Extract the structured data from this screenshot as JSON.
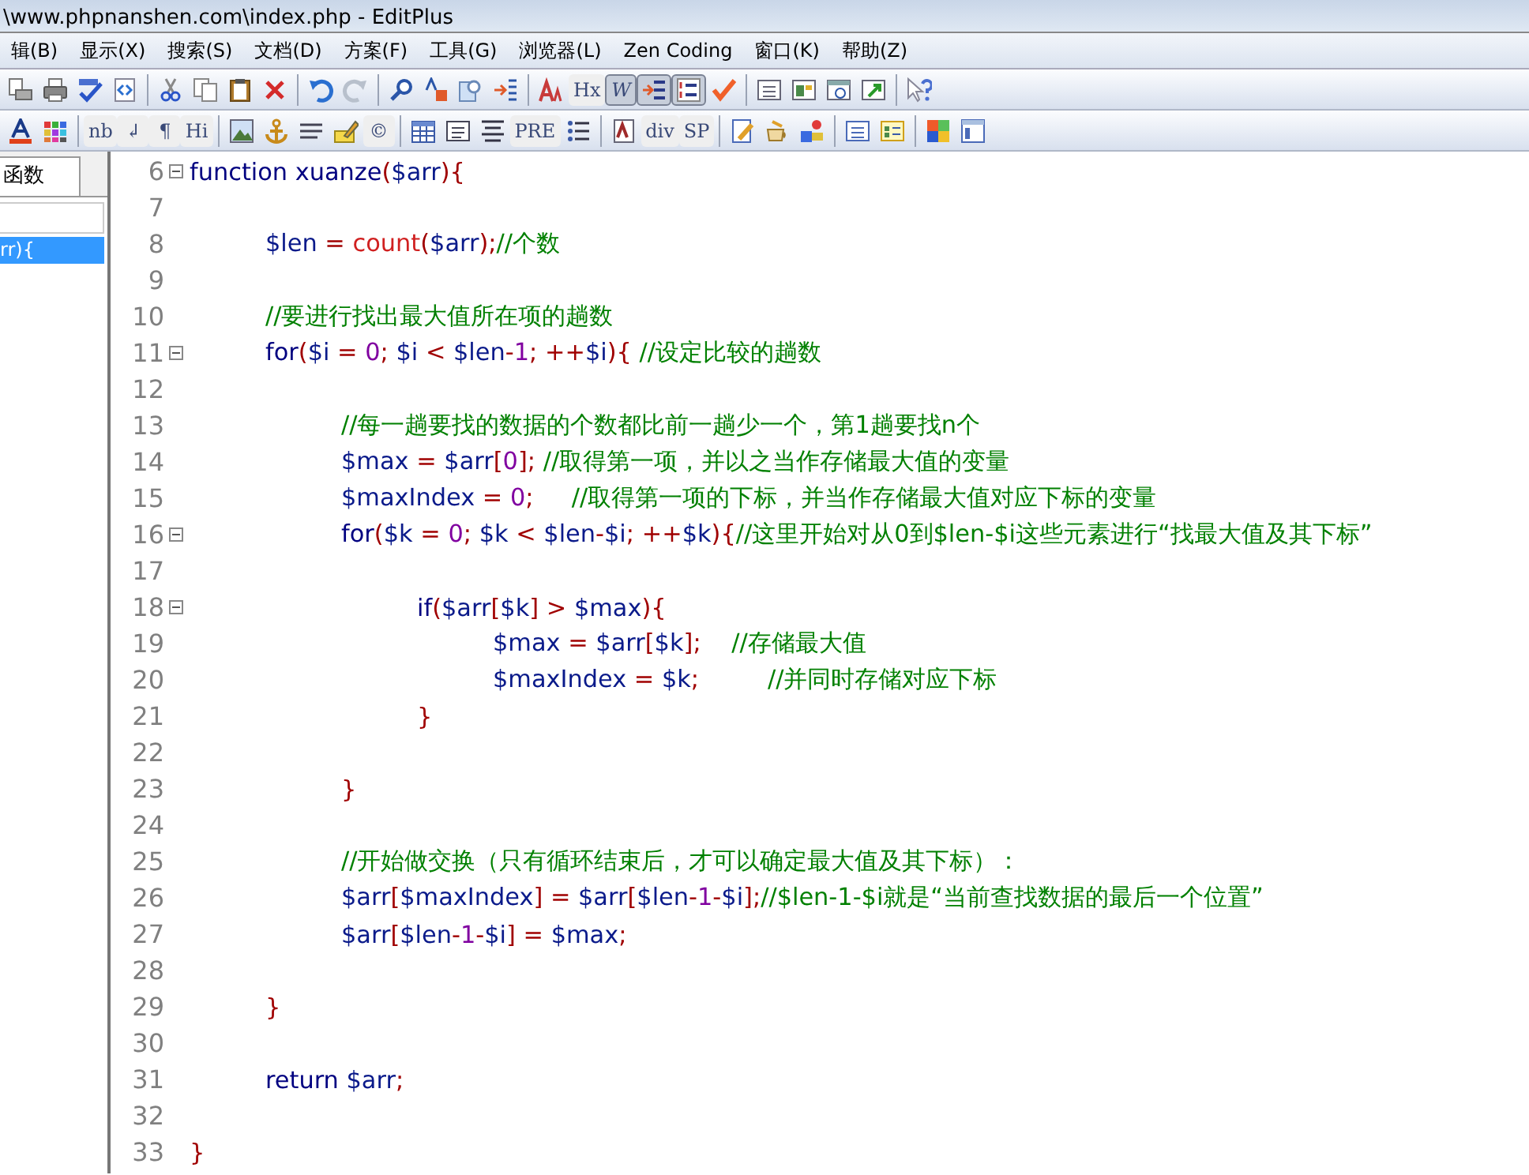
{
  "window": {
    "title": "\\www.phpnanshen.com\\index.php - EditPlus"
  },
  "menu": [
    "辑(B)",
    "显示(X)",
    "搜索(S)",
    "文档(D)",
    "方案(F)",
    "工具(G)",
    "浏览器(L)",
    "Zen Coding",
    "窗口(K)",
    "帮助(Z)"
  ],
  "toolbars": [
    [
      {
        "kind": "icon"
      },
      {
        "kind": "icon"
      },
      {
        "kind": "icon"
      },
      {
        "kind": "icon"
      },
      {
        "kind": "sep"
      },
      {
        "kind": "icon"
      },
      {
        "kind": "icon"
      },
      {
        "kind": "icon"
      },
      {
        "kind": "icon"
      },
      {
        "kind": "sep"
      },
      {
        "kind": "icon"
      },
      {
        "kind": "icon"
      },
      {
        "kind": "sep"
      },
      {
        "kind": "icon"
      },
      {
        "kind": "icon"
      },
      {
        "kind": "icon"
      },
      {
        "kind": "icon"
      },
      {
        "kind": "sep"
      },
      {
        "kind": "icon"
      },
      {
        "kind": "text",
        "label": "Hx",
        "selected": false
      },
      {
        "kind": "text",
        "label": "W",
        "selected": true
      },
      {
        "kind": "icon",
        "selected": true
      },
      {
        "kind": "icon",
        "selected": true
      },
      {
        "kind": "icon"
      },
      {
        "kind": "sep"
      },
      {
        "kind": "icon"
      },
      {
        "kind": "icon"
      },
      {
        "kind": "icon"
      },
      {
        "kind": "icon"
      },
      {
        "kind": "sep"
      },
      {
        "kind": "icon"
      }
    ],
    [
      {
        "kind": "icon"
      },
      {
        "kind": "icon"
      },
      {
        "kind": "sep"
      },
      {
        "kind": "text",
        "label": "nb",
        "selected": false
      },
      {
        "kind": "text",
        "label": "↲",
        "selected": false
      },
      {
        "kind": "text",
        "label": "¶",
        "selected": false
      },
      {
        "kind": "text",
        "label": "Hi",
        "selected": false
      },
      {
        "kind": "sep"
      },
      {
        "kind": "icon"
      },
      {
        "kind": "icon"
      },
      {
        "kind": "icon"
      },
      {
        "kind": "icon"
      },
      {
        "kind": "text",
        "label": "©",
        "selected": false
      },
      {
        "kind": "sep"
      },
      {
        "kind": "icon"
      },
      {
        "kind": "icon"
      },
      {
        "kind": "icon"
      },
      {
        "kind": "text",
        "label": "PRE",
        "selected": false
      },
      {
        "kind": "icon"
      },
      {
        "kind": "sep"
      },
      {
        "kind": "icon"
      },
      {
        "kind": "text",
        "label": "div",
        "selected": false
      },
      {
        "kind": "text",
        "label": "SP",
        "selected": false
      },
      {
        "kind": "sep"
      },
      {
        "kind": "icon"
      },
      {
        "kind": "icon"
      },
      {
        "kind": "icon"
      },
      {
        "kind": "sep"
      },
      {
        "kind": "icon"
      },
      {
        "kind": "icon"
      },
      {
        "kind": "sep"
      },
      {
        "kind": "icon"
      },
      {
        "kind": "icon"
      }
    ]
  ],
  "side_panel": {
    "tab": {
      "label": "函数",
      "selected": true
    },
    "items": [
      {
        "text": "rr){",
        "selected": true
      }
    ]
  },
  "editor": {
    "lines": [
      {
        "number": "6",
        "fold": true,
        "tokens": [
          {
            "kind": "kw",
            "text": "function xuanze"
          },
          {
            "kind": "op",
            "text": "("
          },
          {
            "kind": "var",
            "text": "$arr"
          },
          {
            "kind": "op",
            "text": "){"
          }
        ]
      },
      {
        "number": "7",
        "fold": false
      },
      {
        "number": "8",
        "fold": false,
        "tokens": [
          {
            "kind": "var",
            "text": "\t$len"
          },
          {
            "kind": "op",
            "text": " = "
          },
          {
            "kind": "fn",
            "text": "count"
          },
          {
            "kind": "op",
            "text": "("
          },
          {
            "kind": "var",
            "text": "$arr"
          },
          {
            "kind": "op",
            "text": ");"
          },
          {
            "kind": "cmt",
            "text": "//个数"
          }
        ]
      },
      {
        "number": "9",
        "fold": false
      },
      {
        "number": "10",
        "fold": false,
        "tokens": [
          {
            "kind": "cmt",
            "text": "\t//要进行找出最大值所在项的趟数"
          }
        ]
      },
      {
        "number": "11",
        "fold": true,
        "tokens": [
          {
            "kind": "kw",
            "text": "\tfor"
          },
          {
            "kind": "op",
            "text": "("
          },
          {
            "kind": "var",
            "text": "$i"
          },
          {
            "kind": "op",
            "text": " = "
          },
          {
            "kind": "num",
            "text": "0"
          },
          {
            "kind": "op",
            "text": "; "
          },
          {
            "kind": "var",
            "text": "$i"
          },
          {
            "kind": "op",
            "text": " < "
          },
          {
            "kind": "var",
            "text": "$len"
          },
          {
            "kind": "op",
            "text": "-"
          },
          {
            "kind": "num",
            "text": "1"
          },
          {
            "kind": "op",
            "text": "; ++"
          },
          {
            "kind": "var",
            "text": "$i"
          },
          {
            "kind": "op",
            "text": "){ "
          },
          {
            "kind": "cmt",
            "text": "//设定比较的趟数"
          }
        ]
      },
      {
        "number": "12",
        "fold": false
      },
      {
        "number": "13",
        "fold": false,
        "tokens": [
          {
            "kind": "cmt",
            "text": "\t\t//每一趟要找的数据的个数都比前一趟少一个，第1趟要找n个"
          }
        ]
      },
      {
        "number": "14",
        "fold": false,
        "tokens": [
          {
            "kind": "var",
            "text": "\t\t$max"
          },
          {
            "kind": "op",
            "text": " = "
          },
          {
            "kind": "var",
            "text": "$arr"
          },
          {
            "kind": "op",
            "text": "["
          },
          {
            "kind": "num",
            "text": "0"
          },
          {
            "kind": "op",
            "text": "]; "
          },
          {
            "kind": "cmt",
            "text": "//取得第一项，并以之当作存储最大值的变量"
          }
        ]
      },
      {
        "number": "15",
        "fold": false,
        "tokens": [
          {
            "kind": "var",
            "text": "\t\t$maxIndex"
          },
          {
            "kind": "op",
            "text": " = "
          },
          {
            "kind": "num",
            "text": "0"
          },
          {
            "kind": "op",
            "text": ";     "
          },
          {
            "kind": "cmt",
            "text": "//取得第一项的下标，并当作存储最大值对应下标的变量"
          }
        ]
      },
      {
        "number": "16",
        "fold": true,
        "tokens": [
          {
            "kind": "kw",
            "text": "\t\tfor"
          },
          {
            "kind": "op",
            "text": "("
          },
          {
            "kind": "var",
            "text": "$k"
          },
          {
            "kind": "op",
            "text": " = "
          },
          {
            "kind": "num",
            "text": "0"
          },
          {
            "kind": "op",
            "text": "; "
          },
          {
            "kind": "var",
            "text": "$k"
          },
          {
            "kind": "op",
            "text": " < "
          },
          {
            "kind": "var",
            "text": "$len"
          },
          {
            "kind": "op",
            "text": "-"
          },
          {
            "kind": "var",
            "text": "$i"
          },
          {
            "kind": "op",
            "text": "; ++"
          },
          {
            "kind": "var",
            "text": "$k"
          },
          {
            "kind": "op",
            "text": "){"
          },
          {
            "kind": "cmt",
            "text": "//这里开始对从0到$len-$i这些元素进行“找最大值及其下标”"
          }
        ]
      },
      {
        "number": "17",
        "fold": false
      },
      {
        "number": "18",
        "fold": true,
        "tokens": [
          {
            "kind": "kw",
            "text": "\t\t\tif"
          },
          {
            "kind": "op",
            "text": "("
          },
          {
            "kind": "var",
            "text": "$arr"
          },
          {
            "kind": "op",
            "text": "["
          },
          {
            "kind": "var",
            "text": "$k"
          },
          {
            "kind": "op",
            "text": "] > "
          },
          {
            "kind": "var",
            "text": "$max"
          },
          {
            "kind": "op",
            "text": "){"
          }
        ]
      },
      {
        "number": "19",
        "fold": false,
        "tokens": [
          {
            "kind": "var",
            "text": "\t\t\t\t$max"
          },
          {
            "kind": "op",
            "text": " = "
          },
          {
            "kind": "var",
            "text": "$arr"
          },
          {
            "kind": "op",
            "text": "["
          },
          {
            "kind": "var",
            "text": "$k"
          },
          {
            "kind": "op",
            "text": "];    "
          },
          {
            "kind": "cmt",
            "text": "//存储最大值"
          }
        ]
      },
      {
        "number": "20",
        "fold": false,
        "tokens": [
          {
            "kind": "var",
            "text": "\t\t\t\t$maxIndex"
          },
          {
            "kind": "op",
            "text": " = "
          },
          {
            "kind": "var",
            "text": "$k"
          },
          {
            "kind": "op",
            "text": ";         "
          },
          {
            "kind": "cmt",
            "text": "//并同时存储对应下标"
          }
        ]
      },
      {
        "number": "21",
        "fold": false,
        "tokens": [
          {
            "kind": "op",
            "text": "\t\t\t}"
          }
        ]
      },
      {
        "number": "22",
        "fold": false
      },
      {
        "number": "23",
        "fold": false,
        "tokens": [
          {
            "kind": "op",
            "text": "\t\t}"
          }
        ]
      },
      {
        "number": "24",
        "fold": false
      },
      {
        "number": "25",
        "fold": false,
        "tokens": [
          {
            "kind": "cmt",
            "text": "\t\t//开始做交换（只有循环结束后，才可以确定最大值及其下标）："
          }
        ]
      },
      {
        "number": "26",
        "fold": false,
        "tokens": [
          {
            "kind": "var",
            "text": "\t\t$arr"
          },
          {
            "kind": "op",
            "text": "["
          },
          {
            "kind": "var",
            "text": "$maxIndex"
          },
          {
            "kind": "op",
            "text": "] = "
          },
          {
            "kind": "var",
            "text": "$arr"
          },
          {
            "kind": "op",
            "text": "["
          },
          {
            "kind": "var",
            "text": "$len"
          },
          {
            "kind": "op",
            "text": "-"
          },
          {
            "kind": "num",
            "text": "1"
          },
          {
            "kind": "op",
            "text": "-"
          },
          {
            "kind": "var",
            "text": "$i"
          },
          {
            "kind": "op",
            "text": "];"
          },
          {
            "kind": "cmt",
            "text": "//$len-1-$i就是“当前查找数据的最后一个位置”"
          }
        ]
      },
      {
        "number": "27",
        "fold": false,
        "tokens": [
          {
            "kind": "var",
            "text": "\t\t$arr"
          },
          {
            "kind": "op",
            "text": "["
          },
          {
            "kind": "var",
            "text": "$len"
          },
          {
            "kind": "op",
            "text": "-"
          },
          {
            "kind": "num",
            "text": "1"
          },
          {
            "kind": "op",
            "text": "-"
          },
          {
            "kind": "var",
            "text": "$i"
          },
          {
            "kind": "op",
            "text": "] = "
          },
          {
            "kind": "var",
            "text": "$max"
          },
          {
            "kind": "op",
            "text": ";"
          }
        ]
      },
      {
        "number": "28",
        "fold": false
      },
      {
        "number": "29",
        "fold": false,
        "tokens": [
          {
            "kind": "op",
            "text": "\t}"
          }
        ]
      },
      {
        "number": "30",
        "fold": false
      },
      {
        "number": "31",
        "fold": false,
        "tokens": [
          {
            "kind": "kw",
            "text": "\treturn "
          },
          {
            "kind": "var",
            "text": "$arr"
          },
          {
            "kind": "op",
            "text": ";"
          }
        ]
      },
      {
        "number": "32",
        "fold": false
      },
      {
        "number": "33",
        "fold": false,
        "tokens": [
          {
            "kind": "op",
            "text": "}"
          }
        ]
      }
    ]
  }
}
